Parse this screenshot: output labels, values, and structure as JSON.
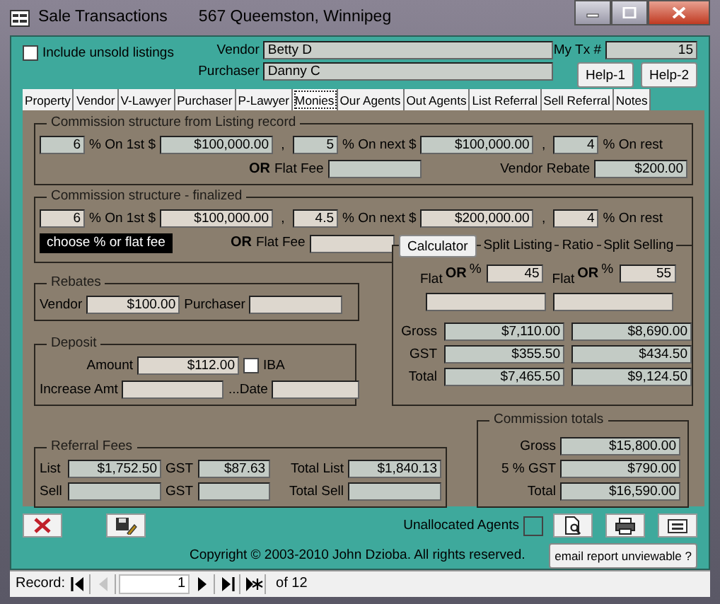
{
  "window": {
    "title": "Sale Transactions",
    "subtitle": "567 Queemston, Winnipeg"
  },
  "include_unsold": {
    "label": "Include unsold listings",
    "checked": false
  },
  "vendor": {
    "label": "Vendor",
    "value": "Betty D"
  },
  "purchaser": {
    "label": "Purchaser",
    "value": "Danny C"
  },
  "tx": {
    "label": "My Tx #",
    "value": "15"
  },
  "help_buttons": [
    "Help-1",
    "Help-2"
  ],
  "tabs": [
    {
      "label": "Property",
      "selected": false
    },
    {
      "label": "Vendor",
      "selected": false
    },
    {
      "label": "V-Lawyer",
      "selected": false
    },
    {
      "label": "Purchaser",
      "selected": false
    },
    {
      "label": "P-Lawyer",
      "selected": false
    },
    {
      "label": "Monies",
      "selected": true
    },
    {
      "label": "Our Agents",
      "selected": false
    },
    {
      "label": "Out Agents",
      "selected": false
    },
    {
      "label": "List Referral",
      "selected": false
    },
    {
      "label": "Sell Referral",
      "selected": false
    },
    {
      "label": "Notes",
      "selected": false
    }
  ],
  "listing_structure": {
    "title": "Commission structure from Listing record",
    "tiers": [
      {
        "rate": "6",
        "label": "% On 1st $",
        "amount": "$100,000.00",
        "after": ","
      },
      {
        "rate": "5",
        "label": "% On next $",
        "amount": "$100,000.00",
        "after": ","
      },
      {
        "rate": "4",
        "label": "% On rest"
      }
    ],
    "or": "OR",
    "flat_fee_label": "Flat Fee",
    "rebate_label": "Vendor Rebate",
    "rebate": "$200.00"
  },
  "final_structure": {
    "title": "Commission structure - finalized",
    "tiers": [
      {
        "rate": "6",
        "label": "% On 1st $",
        "amount": "$100,000.00",
        "after": ","
      },
      {
        "rate": "4.5",
        "label": "% On next $",
        "amount": "$200,000.00",
        "after": ","
      },
      {
        "rate": "4",
        "label": "% On rest"
      }
    ],
    "hint": "choose % or flat fee",
    "or": "OR",
    "flat_fee_label": "Flat Fee"
  },
  "calculator": {
    "button": "Calculator",
    "legends": [
      "Split Listing",
      "Ratio",
      "Split Selling"
    ],
    "sides": [
      {
        "flat_label": "Flat",
        "or": "OR",
        "pct": "%",
        "ratio": "45"
      },
      {
        "flat_label": "Flat",
        "or": "OR",
        "pct": "%",
        "ratio": "55"
      }
    ],
    "rows": [
      {
        "label": "Gross",
        "values": [
          "$7,110.00",
          "$8,690.00"
        ]
      },
      {
        "label": "GST",
        "values": [
          "$355.50",
          "$434.50"
        ]
      },
      {
        "label": "Total",
        "values": [
          "$7,465.50",
          "$9,124.50"
        ]
      }
    ]
  },
  "rebates": {
    "title": "Rebates",
    "vendor_label": "Vendor",
    "vendor": "$100.00",
    "purchaser_label": "Purchaser"
  },
  "deposit": {
    "title": "Deposit",
    "amount_label": "Amount",
    "amount": "$112.00",
    "iba": {
      "label": "IBA",
      "checked": false
    },
    "increase_label": "Increase Amt",
    "date_label": "...Date"
  },
  "referral": {
    "title": "Referral Fees",
    "rows": [
      {
        "label": "List",
        "value": "$1,752.50",
        "gst_label": "GST",
        "gst": "$87.63",
        "total_label": "Total List",
        "total": "$1,840.13"
      },
      {
        "label": "Sell",
        "gst_label": "GST",
        "total_label": "Total Sell"
      }
    ]
  },
  "totals": {
    "title": "Commission totals",
    "rows": [
      {
        "label": "Gross",
        "value": "$15,800.00"
      },
      {
        "label": "5 % GST",
        "value": "$790.00"
      },
      {
        "label": "Total",
        "value": "$16,590.00"
      }
    ]
  },
  "footer": {
    "unallocated": {
      "label": "Unallocated Agents",
      "checked": false
    },
    "copyright": "Copyright © 2003-2010 John Dzioba. All rights reserved.",
    "email_button": "email report unviewable ?"
  },
  "record_nav": {
    "label": "Record:",
    "current": "1",
    "of": "of 12",
    "buttons": [
      {
        "kind": "first",
        "disabled": false
      },
      {
        "kind": "prev",
        "disabled": true
      },
      {
        "kind": "next",
        "disabled": false
      },
      {
        "kind": "last",
        "disabled": false
      },
      {
        "kind": "new",
        "disabled": false
      }
    ]
  }
}
